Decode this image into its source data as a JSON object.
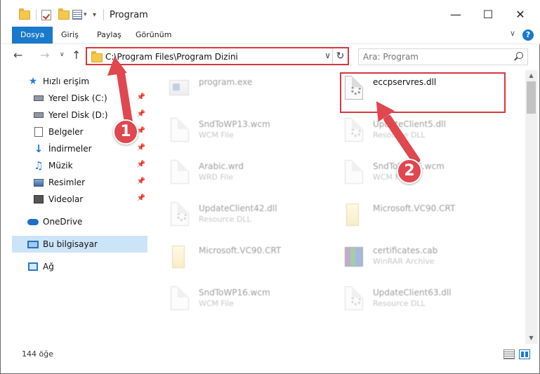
{
  "window": {
    "title": "Program",
    "minimize_icon": "minimize-icon",
    "maximize_icon": "maximize-icon",
    "close_icon": "close-icon"
  },
  "ribbon": {
    "tabs": [
      {
        "label": "Dosya",
        "active": true
      },
      {
        "label": "Giriş",
        "active": false
      },
      {
        "label": "Paylaş",
        "active": false
      },
      {
        "label": "Görünüm",
        "active": false
      }
    ],
    "help": "?"
  },
  "address": {
    "path": "C:\\Program Files\\Program Dizini",
    "search_placeholder": "Ara: Program"
  },
  "nav": {
    "items": [
      {
        "label": "Hızlı erişim",
        "icon": "star-icon",
        "pinned": false
      },
      {
        "label": "Yerel Disk (C:)",
        "icon": "drive-icon",
        "pinned": true
      },
      {
        "label": "Yerel Disk (D:)",
        "icon": "drive-icon",
        "pinned": true
      },
      {
        "label": "Belgeler",
        "icon": "documents-icon",
        "pinned": true
      },
      {
        "label": "İndirmeler",
        "icon": "download-icon",
        "pinned": true
      },
      {
        "label": "Müzik",
        "icon": "music-icon",
        "pinned": true
      },
      {
        "label": "Resimler",
        "icon": "pictures-icon",
        "pinned": true
      },
      {
        "label": "Videolar",
        "icon": "videos-icon",
        "pinned": true
      },
      {
        "label": "OneDrive",
        "icon": "cloud-icon",
        "pinned": false
      },
      {
        "label": "Bu bilgisayar",
        "icon": "computer-icon",
        "pinned": false,
        "selected": true
      },
      {
        "label": "Ağ",
        "icon": "network-icon",
        "pinned": false
      }
    ]
  },
  "files": [
    {
      "name": "program.exe",
      "type": "",
      "icon": "exe-icon",
      "faded": true
    },
    {
      "name": "eccpservres.dll",
      "type": "",
      "icon": "dll-icon",
      "faded": false,
      "highlighted": true
    },
    {
      "name": "SndToWP13.wcm",
      "type": "WCM File",
      "icon": "file-icon",
      "faded": true
    },
    {
      "name": "UpdateClient5.dll",
      "type": "Resource DLL",
      "icon": "dll-icon",
      "faded": true
    },
    {
      "name": "Arabic.wrd",
      "type": "WRD File",
      "icon": "file-icon",
      "faded": true
    },
    {
      "name": "SndToWP16.wcm",
      "type": "WCM File",
      "icon": "file-icon",
      "faded": true
    },
    {
      "name": "UpdateClient42.dll",
      "type": "Resource DLL",
      "icon": "dll-icon",
      "faded": true
    },
    {
      "name": "Microsoft.VC90.CRT",
      "type": "",
      "icon": "folder-doc-icon",
      "faded": true
    },
    {
      "name": "Microsoft.VC90.CRT",
      "type": "",
      "icon": "folder-doc-icon",
      "faded": true
    },
    {
      "name": "certificates.cab",
      "type": "WinRAR Archive",
      "icon": "archive-icon",
      "faded": true
    },
    {
      "name": "SndToWP16.wcm",
      "type": "WCM File",
      "icon": "file-icon",
      "faded": true
    },
    {
      "name": "UpdateClient63.dll",
      "type": "Resource DLL",
      "icon": "dll-icon",
      "faded": true
    }
  ],
  "status": {
    "item_count": "144 öğe"
  },
  "annotations": {
    "badge1": "1",
    "badge2": "2",
    "accent": "#e0474f"
  }
}
